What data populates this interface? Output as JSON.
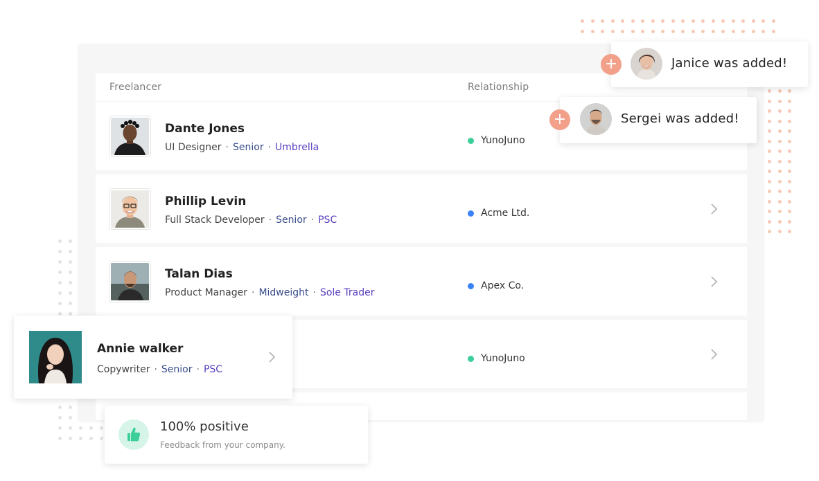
{
  "table": {
    "headers": {
      "freelancer": "Freelancer",
      "relationship": "Relationship"
    },
    "rows": [
      {
        "name": "Dante Jones",
        "role": "UI Designer",
        "level": "Senior",
        "engagement": "Umbrella",
        "company": "YunoJuno",
        "status_color": "#3ccf9a"
      },
      {
        "name": "Phillip Levin",
        "role": "Full Stack Developer",
        "level": "Senior",
        "engagement": "PSC",
        "company": "Acme Ltd.",
        "status_color": "#3b82f6"
      },
      {
        "name": "Talan Dias",
        "role": "Product Manager",
        "level": "Midweight",
        "engagement": "Sole Trader",
        "company": "Apex Co.",
        "status_color": "#3b82f6"
      },
      {
        "name": "",
        "role": "",
        "level": "",
        "engagement": "",
        "company": "YunoJuno",
        "status_color": "#3ccf9a"
      }
    ],
    "separator": "·"
  },
  "notifications": [
    {
      "text": "Janice was added!",
      "icon": "plus-icon",
      "plus_symbol": "+"
    },
    {
      "text": "Sergei was added!",
      "icon": "plus-icon",
      "plus_symbol": "+"
    }
  ],
  "featured": {
    "name": "Annie walker",
    "role": "Copywriter",
    "level": "Senior",
    "engagement": "PSC"
  },
  "feedback": {
    "title": "100% positive",
    "subtitle": "Feedback from your company.",
    "icon": "thumbs-up-icon"
  },
  "colors": {
    "accent_peach": "#f2a08a",
    "status_green": "#3ccf9a",
    "status_blue": "#3b82f6",
    "level_text": "#3a4d8c",
    "engagement_text": "#5a3fc0"
  }
}
